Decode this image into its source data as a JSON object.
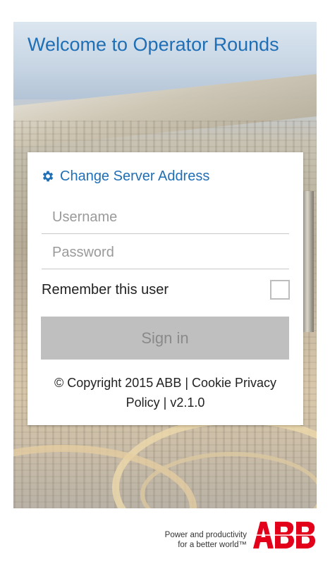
{
  "header": {
    "title": "Welcome to Operator Rounds"
  },
  "login": {
    "change_server_label": "Change Server Address",
    "username_placeholder": "Username",
    "password_placeholder": "Password",
    "remember_label": "Remember this user",
    "remember_checked": false,
    "signin_label": "Sign in",
    "copyright_line": "© Copyright 2015 ABB | Cookie Privacy Policy | v2.1.0"
  },
  "brand": {
    "tagline_line1": "Power and productivity",
    "tagline_line2": "for a better world™",
    "logo_text": "ABB",
    "logo_color": "#e2001a",
    "accent_color": "#1f6fb6"
  },
  "icons": {
    "server": "gear-icon",
    "logo": "abb-logo-icon"
  }
}
